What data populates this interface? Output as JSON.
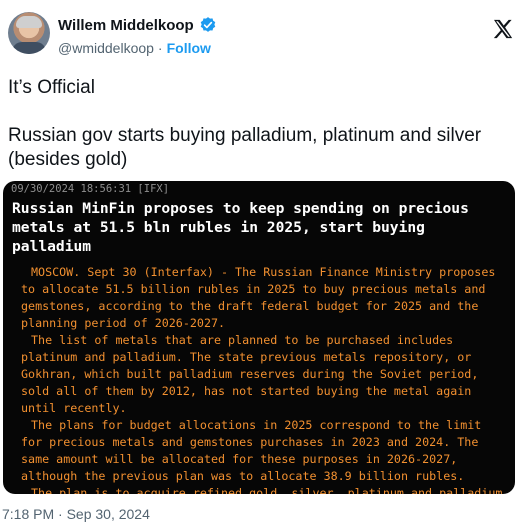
{
  "author": {
    "name": "Willem Middelkoop",
    "handle": "@wmiddelkoop",
    "separator": "·",
    "follow_label": "Follow"
  },
  "tweet": {
    "line1": "It’s Official",
    "line2": "Russian gov starts buying palladium, platinum and silver (besides gold)"
  },
  "news_image": {
    "stamp": "09/30/2024 18:56:31 [IFX]",
    "headline": "Russian MinFin proposes to keep spending on precious metals at 51.5 bln rubles in 2025, start buying palladium",
    "paragraphs": [
      "MOSCOW. Sept 30 (Interfax) - The Russian Finance Ministry proposes to allocate 51.5 billion rubles in 2025 to buy precious metals and gemstones, according to the draft federal budget for 2025 and the planning period of 2026-2027.",
      "The list of metals that are planned to be purchased includes platinum and palladium. The state previous metals repository, or Gokhran, which built palladium reserves during the Soviet period, sold all of them by 2012, has not started buying the metal again until recently.",
      "The plans for budget allocations in 2025 correspond to the limit for precious metals and gemstones purchases in 2023 and 2024. The same amount will be allocated for these purposes in 2026-2027, although the previous plan was to allocate 38.9 billion rubles.",
      "The plan is to acquire refined gold, silver, platinum and palladium to increase the share of highly liquid assets in the State Fund, the explanatory note says."
    ]
  },
  "timestamp": "7:18 PM · Sep 30, 2024",
  "colors": {
    "accent": "#1d9bf0",
    "article_text": "#f29030",
    "image_bg": "#060606"
  },
  "icons": [
    "avatar",
    "verified-badge-icon",
    "x-logo-icon"
  ]
}
